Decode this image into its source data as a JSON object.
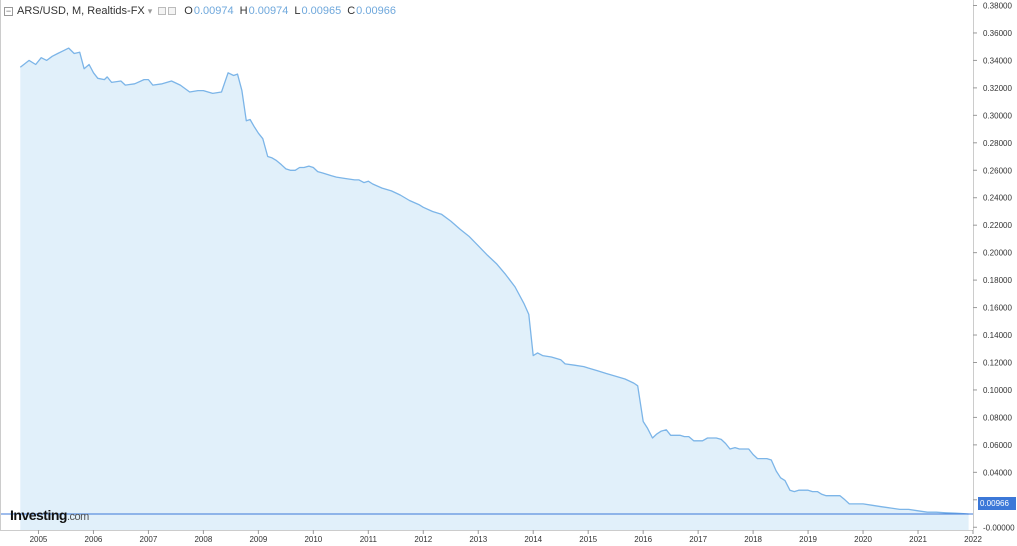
{
  "legend": {
    "symbol": "ARS/USD, M, Realtids-FX",
    "o_key": "O",
    "o_val": "0.00974",
    "h_key": "H",
    "h_val": "0.00974",
    "l_key": "L",
    "l_val": "0.00965",
    "c_key": "C",
    "c_val": "0.00966"
  },
  "logo": {
    "brand": "Investing",
    "suffix": ".com"
  },
  "price_label": "0.00966",
  "colors": {
    "line": "#7cb5e8",
    "fill": "#e1f0fa",
    "axis": "#cccccc",
    "price_box": "#3c78d8"
  },
  "chart_data": {
    "type": "area",
    "title": "ARS/USD, M, Realtids-FX",
    "xlabel": "",
    "ylabel": "",
    "ylim": [
      -0.002,
      0.384
    ],
    "xlim": [
      2004.3,
      2022.0
    ],
    "grid": false,
    "x_ticks": [
      2005,
      2006,
      2007,
      2008,
      2009,
      2010,
      2011,
      2012,
      2013,
      2014,
      2015,
      2016,
      2017,
      2018,
      2019,
      2020,
      2021,
      2022
    ],
    "y_ticks": [
      0.0,
      0.02,
      0.04,
      0.06,
      0.08,
      0.1,
      0.12,
      0.14,
      0.16,
      0.18,
      0.2,
      0.22,
      0.24,
      0.26,
      0.28,
      0.3,
      0.32,
      0.34,
      0.36,
      0.38
    ],
    "y_tick_labels": [
      "-0.00000",
      "0.02000",
      "0.04000",
      "0.06000",
      "0.08000",
      "0.10000",
      "0.12000",
      "0.14000",
      "0.16000",
      "0.18000",
      "0.20000",
      "0.22000",
      "0.24000",
      "0.26000",
      "0.28000",
      "0.30000",
      "0.32000",
      "0.34000",
      "0.36000",
      "0.38000"
    ],
    "current_value": 0.00966,
    "series": [
      {
        "values": [
          [
            2004.67,
            0.335
          ],
          [
            2004.83,
            0.34
          ],
          [
            2004.95,
            0.337
          ],
          [
            2005.05,
            0.342
          ],
          [
            2005.15,
            0.34
          ],
          [
            2005.25,
            0.343
          ],
          [
            2005.35,
            0.345
          ],
          [
            2005.45,
            0.347
          ],
          [
            2005.55,
            0.349
          ],
          [
            2005.65,
            0.345
          ],
          [
            2005.75,
            0.346
          ],
          [
            2005.83,
            0.334
          ],
          [
            2005.92,
            0.337
          ],
          [
            2006.0,
            0.331
          ],
          [
            2006.08,
            0.327
          ],
          [
            2006.2,
            0.326
          ],
          [
            2006.25,
            0.328
          ],
          [
            2006.33,
            0.324
          ],
          [
            2006.5,
            0.325
          ],
          [
            2006.58,
            0.322
          ],
          [
            2006.75,
            0.323
          ],
          [
            2006.92,
            0.326
          ],
          [
            2007.0,
            0.326
          ],
          [
            2007.08,
            0.322
          ],
          [
            2007.25,
            0.323
          ],
          [
            2007.42,
            0.325
          ],
          [
            2007.58,
            0.322
          ],
          [
            2007.75,
            0.317
          ],
          [
            2007.9,
            0.318
          ],
          [
            2008.0,
            0.318
          ],
          [
            2008.17,
            0.316
          ],
          [
            2008.33,
            0.317
          ],
          [
            2008.45,
            0.331
          ],
          [
            2008.55,
            0.329
          ],
          [
            2008.62,
            0.33
          ],
          [
            2008.7,
            0.318
          ],
          [
            2008.78,
            0.296
          ],
          [
            2008.85,
            0.297
          ],
          [
            2008.92,
            0.292
          ],
          [
            2009.0,
            0.287
          ],
          [
            2009.08,
            0.283
          ],
          [
            2009.17,
            0.27
          ],
          [
            2009.25,
            0.269
          ],
          [
            2009.33,
            0.267
          ],
          [
            2009.42,
            0.264
          ],
          [
            2009.5,
            0.261
          ],
          [
            2009.58,
            0.26
          ],
          [
            2009.67,
            0.26
          ],
          [
            2009.75,
            0.262
          ],
          [
            2009.83,
            0.262
          ],
          [
            2009.92,
            0.263
          ],
          [
            2010.0,
            0.262
          ],
          [
            2010.08,
            0.259
          ],
          [
            2010.17,
            0.258
          ],
          [
            2010.33,
            0.256
          ],
          [
            2010.42,
            0.255
          ],
          [
            2010.58,
            0.254
          ],
          [
            2010.75,
            0.253
          ],
          [
            2010.83,
            0.253
          ],
          [
            2010.92,
            0.251
          ],
          [
            2011.0,
            0.252
          ],
          [
            2011.08,
            0.25
          ],
          [
            2011.25,
            0.247
          ],
          [
            2011.42,
            0.245
          ],
          [
            2011.58,
            0.242
          ],
          [
            2011.75,
            0.238
          ],
          [
            2011.92,
            0.235
          ],
          [
            2012.0,
            0.233
          ],
          [
            2012.17,
            0.23
          ],
          [
            2012.33,
            0.228
          ],
          [
            2012.5,
            0.223
          ],
          [
            2012.67,
            0.217
          ],
          [
            2012.83,
            0.212
          ],
          [
            2013.0,
            0.205
          ],
          [
            2013.17,
            0.198
          ],
          [
            2013.33,
            0.192
          ],
          [
            2013.5,
            0.184
          ],
          [
            2013.67,
            0.175
          ],
          [
            2013.83,
            0.163
          ],
          [
            2013.92,
            0.155
          ],
          [
            2014.0,
            0.125
          ],
          [
            2014.08,
            0.127
          ],
          [
            2014.17,
            0.125
          ],
          [
            2014.33,
            0.124
          ],
          [
            2014.5,
            0.122
          ],
          [
            2014.58,
            0.119
          ],
          [
            2014.75,
            0.118
          ],
          [
            2014.92,
            0.117
          ],
          [
            2015.0,
            0.116
          ],
          [
            2015.17,
            0.114
          ],
          [
            2015.33,
            0.112
          ],
          [
            2015.5,
            0.11
          ],
          [
            2015.67,
            0.108
          ],
          [
            2015.83,
            0.105
          ],
          [
            2015.9,
            0.103
          ],
          [
            2016.0,
            0.077
          ],
          [
            2016.08,
            0.072
          ],
          [
            2016.17,
            0.065
          ],
          [
            2016.25,
            0.068
          ],
          [
            2016.33,
            0.07
          ],
          [
            2016.42,
            0.071
          ],
          [
            2016.5,
            0.067
          ],
          [
            2016.67,
            0.067
          ],
          [
            2016.75,
            0.066
          ],
          [
            2016.83,
            0.066
          ],
          [
            2016.92,
            0.063
          ],
          [
            2017.0,
            0.063
          ],
          [
            2017.08,
            0.063
          ],
          [
            2017.17,
            0.065
          ],
          [
            2017.33,
            0.065
          ],
          [
            2017.42,
            0.064
          ],
          [
            2017.5,
            0.061
          ],
          [
            2017.58,
            0.057
          ],
          [
            2017.67,
            0.058
          ],
          [
            2017.75,
            0.057
          ],
          [
            2017.83,
            0.057
          ],
          [
            2017.92,
            0.057
          ],
          [
            2018.0,
            0.053
          ],
          [
            2018.08,
            0.05
          ],
          [
            2018.25,
            0.05
          ],
          [
            2018.33,
            0.049
          ],
          [
            2018.42,
            0.041
          ],
          [
            2018.5,
            0.036
          ],
          [
            2018.58,
            0.034
          ],
          [
            2018.67,
            0.027
          ],
          [
            2018.75,
            0.026
          ],
          [
            2018.83,
            0.027
          ],
          [
            2018.92,
            0.027
          ],
          [
            2019.0,
            0.027
          ],
          [
            2019.08,
            0.026
          ],
          [
            2019.17,
            0.026
          ],
          [
            2019.25,
            0.024
          ],
          [
            2019.33,
            0.023
          ],
          [
            2019.42,
            0.023
          ],
          [
            2019.5,
            0.023
          ],
          [
            2019.58,
            0.023
          ],
          [
            2019.67,
            0.02
          ],
          [
            2019.75,
            0.017
          ],
          [
            2019.83,
            0.017
          ],
          [
            2020.0,
            0.017
          ],
          [
            2020.17,
            0.016
          ],
          [
            2020.33,
            0.015
          ],
          [
            2020.5,
            0.014
          ],
          [
            2020.67,
            0.013
          ],
          [
            2020.83,
            0.013
          ],
          [
            2021.0,
            0.012
          ],
          [
            2021.17,
            0.011
          ],
          [
            2021.33,
            0.011
          ],
          [
            2021.5,
            0.0105
          ],
          [
            2021.67,
            0.0102
          ],
          [
            2021.83,
            0.0099
          ],
          [
            2021.92,
            0.00966
          ]
        ]
      }
    ]
  }
}
